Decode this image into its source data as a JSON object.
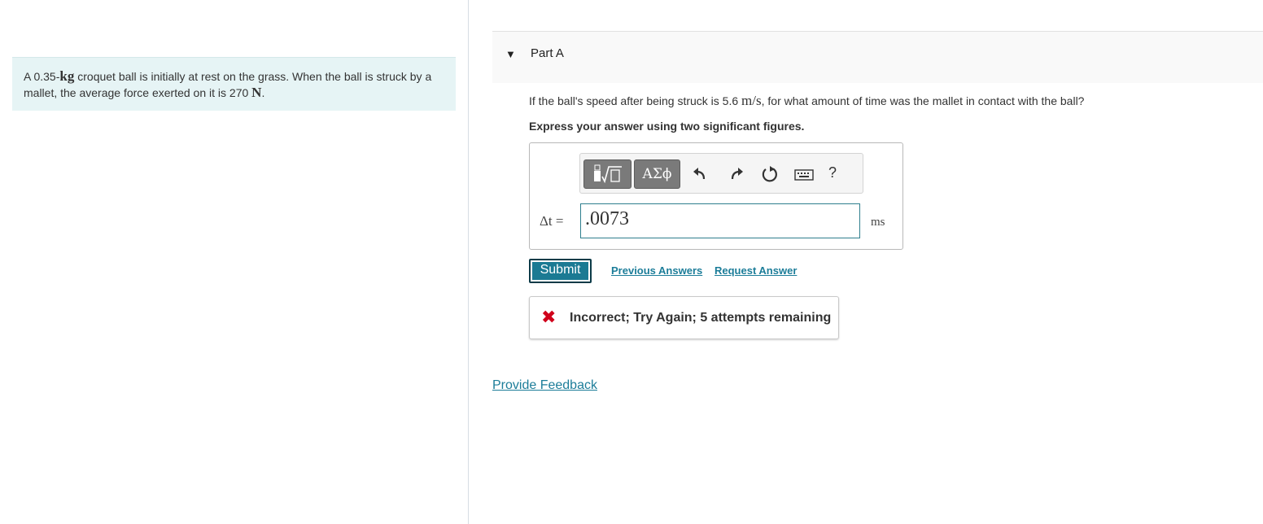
{
  "problem": {
    "text_before_mass": "A ",
    "mass_value": "0.35",
    "mass_unit": "kg",
    "text_after_mass": " croquet ball is initially at rest on the grass. When the ball is struck by a mallet, the average force exerted on it is ",
    "force_value": "270",
    "force_unit": "N",
    "text_end": "."
  },
  "part": {
    "title": "Part A",
    "question_before": "If the ball's speed after being struck is 5.6 ",
    "speed_unit": "m/s",
    "question_after": ", for what amount of time was the mallet in contact with the ball?",
    "instruction": "Express your answer using two significant figures."
  },
  "toolbar": {
    "symbols_label": "ΑΣϕ",
    "help_label": "?",
    "icons": [
      "templates-icon",
      "undo-icon",
      "redo-icon",
      "reset-icon",
      "keyboard-icon",
      "help-icon"
    ]
  },
  "answer": {
    "variable_label": "Δt =",
    "value": ".0073",
    "unit": "ms"
  },
  "actions": {
    "submit_label": "Submit",
    "previous_answers_label": "Previous Answers",
    "request_answer_label": "Request Answer"
  },
  "feedback": {
    "message": "Incorrect; Try Again; 5 attempts remaining",
    "status_color": "#d0021b"
  },
  "footer": {
    "provide_feedback_label": "Provide Feedback"
  },
  "colors": {
    "accent": "#1b7a93",
    "link": "#1c7d99",
    "problem_bg": "#e6f4f5"
  }
}
